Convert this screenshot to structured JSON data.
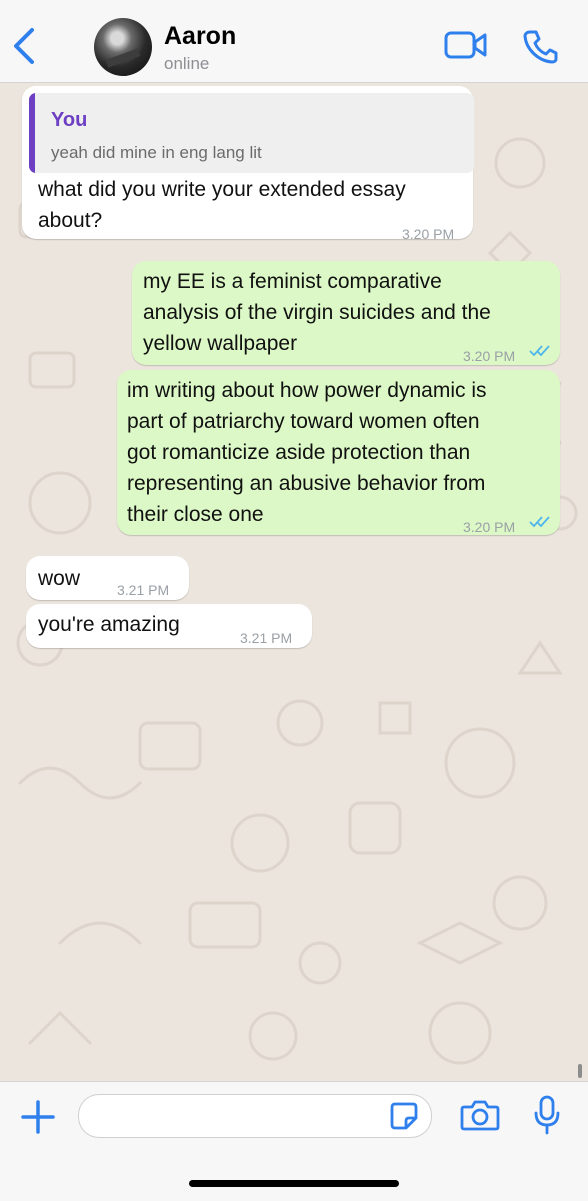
{
  "header": {
    "back_icon": "chevron-left-icon",
    "contact_name": "Aaron",
    "contact_status": "online",
    "video_icon": "video-camera-icon",
    "phone_icon": "phone-icon",
    "accent_color": "#2f80ed"
  },
  "messages": [
    {
      "direction": "incoming",
      "reply_to": {
        "sender": "You",
        "text": "yeah did mine in eng lang lit"
      },
      "text": "what did you write your extended essay\nabout?",
      "time": "3.20 PM"
    },
    {
      "direction": "outgoing",
      "text": "my EE is a feminist comparative\nanalysis of the virgin suicides and the\nyellow wallpaper",
      "time": "3.20 PM",
      "read": true
    },
    {
      "direction": "outgoing",
      "text": "im writing about how power dynamic is\npart of patriarchy toward women often\ngot romanticize aside protection than\nrepresenting an abusive behavior from\ntheir close one",
      "time": "3.20 PM",
      "read": true
    },
    {
      "direction": "incoming",
      "text": "wow",
      "time": "3.21 PM"
    },
    {
      "direction": "incoming",
      "text": "you're amazing",
      "time": "3.21 PM"
    }
  ],
  "composer": {
    "plus_icon": "plus-icon",
    "message_value": "",
    "sticker_icon": "sticker-icon",
    "camera_icon": "camera-icon",
    "mic_icon": "microphone-icon"
  },
  "colors": {
    "incoming_bubble": "#ffffff",
    "outgoing_bubble": "#dcf8c6",
    "reply_accent": "#6d3fc3",
    "read_ticks": "#4fb6ec",
    "chat_background": "#ece5dd"
  }
}
